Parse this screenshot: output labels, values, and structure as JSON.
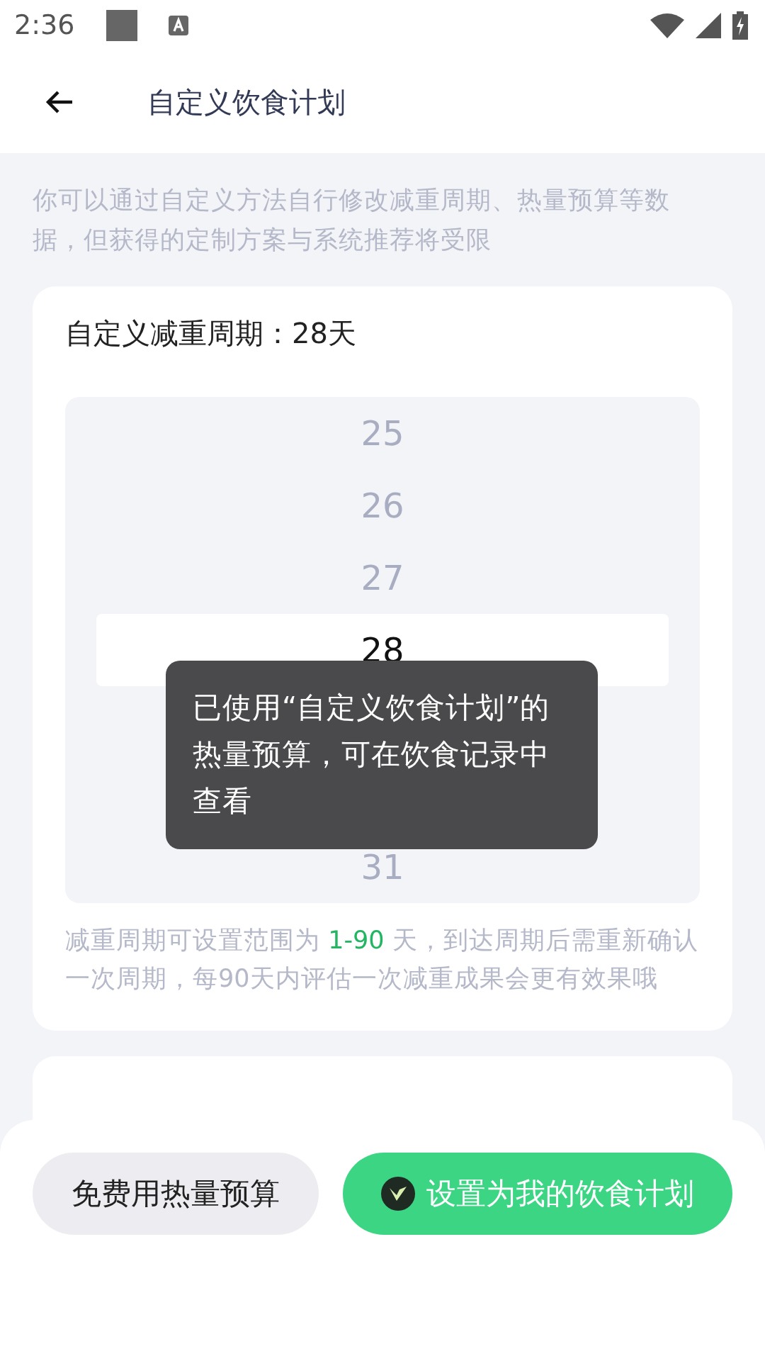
{
  "status_bar": {
    "time": "2:36"
  },
  "header": {
    "title": "自定义饮食计划"
  },
  "intro": "你可以通过自定义方法自行修改减重周期、热量预算等数据，但获得的定制方案与系统推荐将受限",
  "card": {
    "title_label": "自定义减重周期：",
    "title_value": "28天",
    "picker_top": [
      {
        "label": "25",
        "selected": false
      },
      {
        "label": "26",
        "selected": false
      },
      {
        "label": "27",
        "selected": false
      },
      {
        "label": "28",
        "selected": true
      }
    ],
    "picker_bottom": [
      {
        "label": "31",
        "selected": false
      }
    ],
    "note": {
      "before": "减重周期可设置范围为 ",
      "highlight": "1-90",
      "after": " 天，到达周期后需重新确认一次周期，每90天内评估一次减重成果会更有效果哦"
    }
  },
  "toast": "已使用“自定义饮食计划”的热量预算，可在饮食记录中查看",
  "buttons": [
    {
      "kind": "secondary",
      "label": "免费用热量预算"
    },
    {
      "kind": "primary",
      "label": "设置为我的饮食计划"
    }
  ]
}
